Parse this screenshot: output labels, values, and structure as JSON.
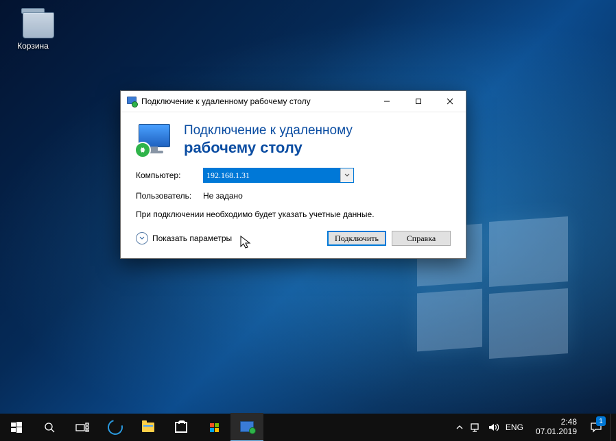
{
  "desktop": {
    "recycle_bin_label": "Корзина"
  },
  "rdp": {
    "window_title": "Подключение к удаленному рабочему столу",
    "heading_line1": "Подключение к удаленному",
    "heading_line2": "рабочему столу",
    "computer_label": "Компьютер:",
    "computer_value": "192.168.1.31",
    "user_label": "Пользователь:",
    "user_value": "Не задано",
    "hint": "При подключении необходимо будет указать учетные данные.",
    "show_options": "Показать параметры",
    "connect_btn": "Подключить",
    "help_btn": "Справка"
  },
  "taskbar": {
    "lang": "ENG",
    "time": "2:48",
    "date": "07.01.2019",
    "notif_count": "1"
  }
}
